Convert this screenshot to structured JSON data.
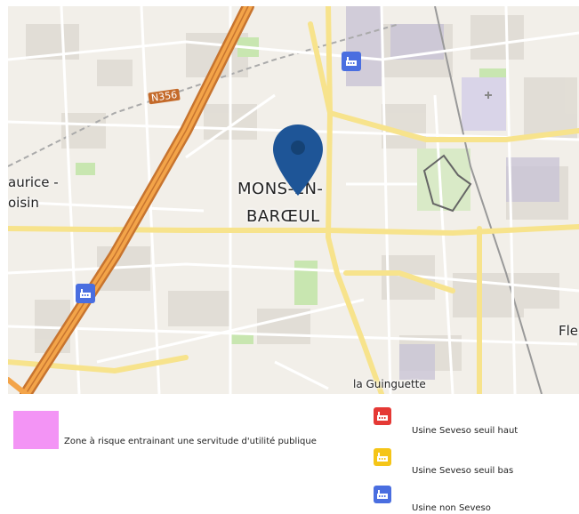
{
  "map": {
    "labels": {
      "city_line1": "MONS-EN-",
      "city_line2": "BARŒUL",
      "place_left_line1": "aurice -",
      "place_left_line2": "oisin",
      "place_right": "Fle",
      "place_bottom": "la Guinguette",
      "road_ref": "N356"
    },
    "markers": [
      {
        "type": "usine-non-seveso-icon",
        "color": "#4a6ee0"
      },
      {
        "type": "usine-non-seveso-icon",
        "color": "#4a6ee0"
      }
    ],
    "location_pin_color": "#1e5597"
  },
  "legend": {
    "zone_label": "Zone à risque entrainant une servitude d'utilité publique",
    "zone_color": "#f394f5",
    "items": [
      {
        "label": "Usine Seveso seuil haut",
        "icon": "factory-icon",
        "color": "#e53935"
      },
      {
        "label": "Usine Seveso seuil bas",
        "icon": "factory-icon",
        "color": "#f5c518"
      },
      {
        "label": "Usine non Seveso",
        "icon": "factory-icon",
        "color": "#4a6ee0"
      }
    ]
  }
}
